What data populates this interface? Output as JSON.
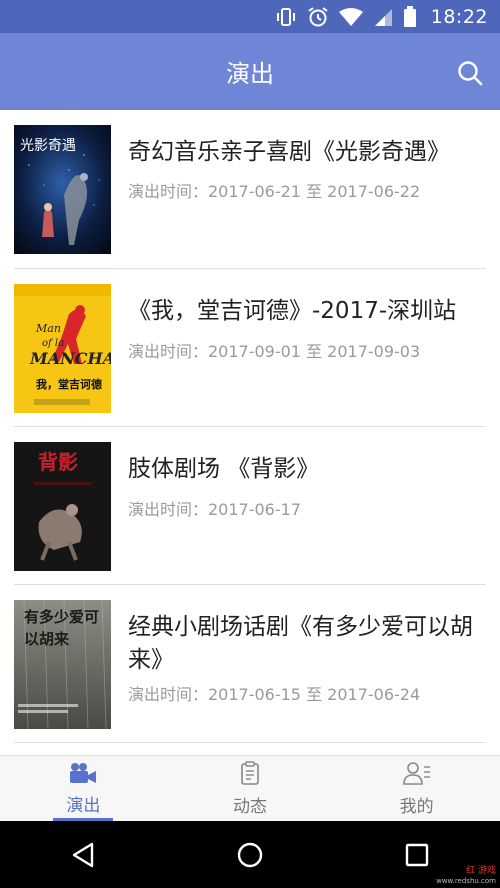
{
  "status_bar": {
    "time": "18:22",
    "icons": [
      "vibrate-icon",
      "alarm-icon",
      "wifi-icon",
      "signal-icon",
      "battery-icon"
    ]
  },
  "app_bar": {
    "title": "演出",
    "search_icon": "search-icon"
  },
  "colors": {
    "status_bar": "#4f67ba",
    "app_bar": "#6f86d6",
    "accent": "#5a72c9",
    "title_text": "#222222",
    "meta_text": "#9a9a9a"
  },
  "shows": [
    {
      "title": "奇幻音乐亲子喜剧《光影奇遇》",
      "time": "演出时间：2017-06-21 至 2017-06-22",
      "poster_text": "光影奇遇"
    },
    {
      "title": "《我，堂吉诃德》-2017-深圳站",
      "time": "演出时间：2017-09-01 至 2017-09-03",
      "poster_text": "我，堂吉诃德"
    },
    {
      "title": "肢体剧场 《背影》",
      "time": "演出时间：2017-06-17",
      "poster_text": "背影"
    },
    {
      "title": "经典小剧场话剧《有多少爱可以胡来》",
      "time": "演出时间：2017-06-15 至 2017-06-24",
      "poster_text": "有多少爱可以胡来"
    }
  ],
  "bottom_nav": {
    "tabs": [
      {
        "label": "演出",
        "icon": "camera-icon",
        "active": true
      },
      {
        "label": "动态",
        "icon": "clipboard-icon",
        "active": false
      },
      {
        "label": "我的",
        "icon": "profile-icon",
        "active": false
      }
    ]
  },
  "system_nav": {
    "buttons": [
      "back-icon",
      "home-icon",
      "recents-icon"
    ]
  },
  "watermark": {
    "brand": "红 游戏",
    "site": "www.redshu.com"
  }
}
